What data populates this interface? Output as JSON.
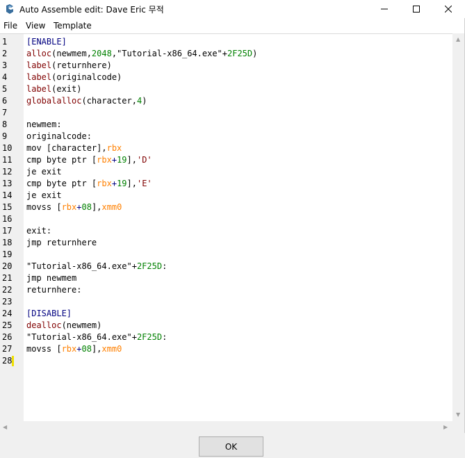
{
  "window": {
    "title": "Auto Assemble edit: Dave Eric 무적",
    "controls": {
      "minimize": "minimize",
      "maximize": "maximize",
      "close": "close"
    }
  },
  "menu": [
    "File",
    "View",
    "Template"
  ],
  "editor": {
    "line_numbers": [
      "1",
      "2",
      "3",
      "4",
      "5",
      "6",
      "7",
      "8",
      "9",
      "10",
      "11",
      "12",
      "13",
      "14",
      "15",
      "16",
      "17",
      "18",
      "19",
      "20",
      "21",
      "22",
      "23",
      "24",
      "25",
      "26",
      "27",
      "28"
    ],
    "lines": [
      [
        {
          "t": "[ENABLE]",
          "c": "sec"
        }
      ],
      [
        {
          "t": "alloc",
          "c": "kw"
        },
        {
          "t": "(newmem,",
          "c": "plain"
        },
        {
          "t": "2048",
          "c": "num"
        },
        {
          "t": ",\"Tutorial-x86_64.exe\"+",
          "c": "plain"
        },
        {
          "t": "2F25D",
          "c": "num"
        },
        {
          "t": ")",
          "c": "plain"
        }
      ],
      [
        {
          "t": "label",
          "c": "kw"
        },
        {
          "t": "(returnhere)",
          "c": "plain"
        }
      ],
      [
        {
          "t": "label",
          "c": "kw"
        },
        {
          "t": "(originalcode)",
          "c": "plain"
        }
      ],
      [
        {
          "t": "label",
          "c": "kw"
        },
        {
          "t": "(exit)",
          "c": "plain"
        }
      ],
      [
        {
          "t": "globalalloc",
          "c": "kw"
        },
        {
          "t": "(character,",
          "c": "plain"
        },
        {
          "t": "4",
          "c": "num"
        },
        {
          "t": ")",
          "c": "plain"
        }
      ],
      [],
      [
        {
          "t": "newmem:",
          "c": "plain"
        }
      ],
      [
        {
          "t": "originalcode:",
          "c": "plain"
        }
      ],
      [
        {
          "t": "mov [character],",
          "c": "plain"
        },
        {
          "t": "rbx",
          "c": "reg"
        }
      ],
      [
        {
          "t": "cmp byte ptr [",
          "c": "plain"
        },
        {
          "t": "rbx",
          "c": "reg"
        },
        {
          "t": "+",
          "c": "op"
        },
        {
          "t": "19",
          "c": "num"
        },
        {
          "t": "],",
          "c": "plain"
        },
        {
          "t": "'D'",
          "c": "str"
        }
      ],
      [
        {
          "t": "je exit",
          "c": "plain"
        }
      ],
      [
        {
          "t": "cmp byte ptr [",
          "c": "plain"
        },
        {
          "t": "rbx",
          "c": "reg"
        },
        {
          "t": "+",
          "c": "op"
        },
        {
          "t": "19",
          "c": "num"
        },
        {
          "t": "],",
          "c": "plain"
        },
        {
          "t": "'E'",
          "c": "str"
        }
      ],
      [
        {
          "t": "je exit",
          "c": "plain"
        }
      ],
      [
        {
          "t": "movss [",
          "c": "plain"
        },
        {
          "t": "rbx",
          "c": "reg"
        },
        {
          "t": "+",
          "c": "op"
        },
        {
          "t": "08",
          "c": "num"
        },
        {
          "t": "],",
          "c": "plain"
        },
        {
          "t": "xmm0",
          "c": "reg"
        }
      ],
      [],
      [
        {
          "t": "exit:",
          "c": "plain"
        }
      ],
      [
        {
          "t": "jmp returnhere",
          "c": "plain"
        }
      ],
      [],
      [
        {
          "t": "\"Tutorial-x86_64.exe\"+",
          "c": "plain"
        },
        {
          "t": "2F25D",
          "c": "num"
        },
        {
          "t": ":",
          "c": "plain"
        }
      ],
      [
        {
          "t": "jmp newmem",
          "c": "plain"
        }
      ],
      [
        {
          "t": "returnhere:",
          "c": "plain"
        }
      ],
      [],
      [
        {
          "t": "[DISABLE]",
          "c": "sec"
        }
      ],
      [
        {
          "t": "dealloc",
          "c": "kw"
        },
        {
          "t": "(newmem)",
          "c": "plain"
        }
      ],
      [
        {
          "t": "\"Tutorial-x86_64.exe\"+",
          "c": "plain"
        },
        {
          "t": "2F25D",
          "c": "num"
        },
        {
          "t": ":",
          "c": "plain"
        }
      ],
      [
        {
          "t": "movss [",
          "c": "plain"
        },
        {
          "t": "rbx",
          "c": "reg"
        },
        {
          "t": "+",
          "c": "op"
        },
        {
          "t": "08",
          "c": "num"
        },
        {
          "t": "],",
          "c": "plain"
        },
        {
          "t": "xmm0",
          "c": "reg"
        }
      ],
      []
    ]
  },
  "buttons": {
    "ok": "OK"
  },
  "colors": {
    "keyword": "#800000",
    "number": "#008000",
    "register": "#ff8000",
    "section": "#000080",
    "gutter": "#f0f0f0",
    "caret": "#f0e000"
  }
}
